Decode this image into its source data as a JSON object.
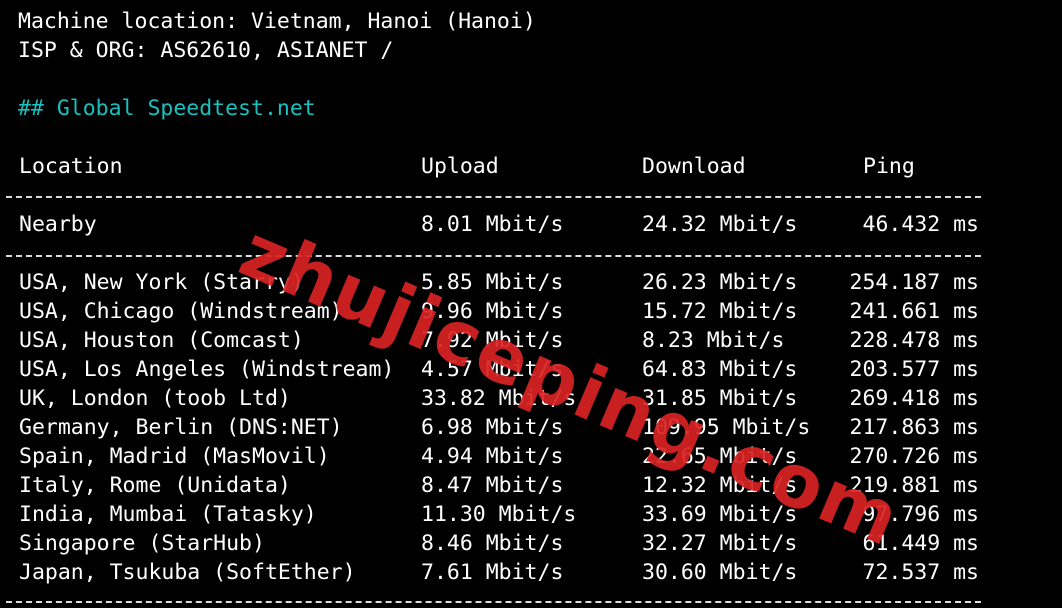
{
  "terminal": {
    "machine_location": "Machine location: Vietnam, Hanoi (Hanoi)",
    "isp_org": "ISP & ORG: AS62610, ASIANET /",
    "section_heading": "## Global Speedtest.net",
    "columns": {
      "location": "Location",
      "upload": "Upload",
      "download": "Download",
      "ping": "Ping"
    },
    "nearby": {
      "location": "Nearby",
      "upload": "8.01 Mbit/s",
      "download": "24.32 Mbit/s",
      "ping": "46.432 ms"
    },
    "rows": [
      {
        "location": "USA, New York (Starry)",
        "upload": "5.85 Mbit/s",
        "download": "26.23 Mbit/s",
        "ping": "254.187 ms"
      },
      {
        "location": "USA, Chicago (Windstream)",
        "upload": "9.96 Mbit/s",
        "download": "15.72 Mbit/s",
        "ping": "241.661 ms"
      },
      {
        "location": "USA, Houston (Comcast)",
        "upload": "7.92 Mbit/s",
        "download": "8.23 Mbit/s",
        "ping": "228.478 ms"
      },
      {
        "location": "USA, Los Angeles (Windstream)",
        "upload": "4.57 Mbit/s",
        "download": "64.83 Mbit/s",
        "ping": "203.577 ms"
      },
      {
        "location": "UK, London (toob Ltd)",
        "upload": "33.82 Mbit/s",
        "download": "31.85 Mbit/s",
        "ping": "269.418 ms"
      },
      {
        "location": "Germany, Berlin (DNS:NET)",
        "upload": "6.98 Mbit/s",
        "download": "109.95 Mbit/s",
        "ping": "217.863 ms"
      },
      {
        "location": "Spain, Madrid (MasMovil)",
        "upload": "4.94 Mbit/s",
        "download": "22.65 Mbit/s",
        "ping": "270.726 ms"
      },
      {
        "location": "Italy, Rome (Unidata)",
        "upload": "8.47 Mbit/s",
        "download": "12.32 Mbit/s",
        "ping": "219.881 ms"
      },
      {
        "location": "India, Mumbai (Tatasky)",
        "upload": "11.30 Mbit/s",
        "download": "33.69 Mbit/s",
        "ping": "97.796 ms"
      },
      {
        "location": "Singapore (StarHub)",
        "upload": "8.46 Mbit/s",
        "download": "32.27 Mbit/s",
        "ping": "61.449 ms"
      },
      {
        "location": "Japan, Tsukuba (SoftEther)",
        "upload": "7.61 Mbit/s",
        "download": "30.60 Mbit/s",
        "ping": "72.537 ms"
      }
    ]
  },
  "watermark": "zhujiceping.com",
  "colors": {
    "background": "#000000",
    "text": "#ffffff",
    "heading": "#19c0c0",
    "watermark": "#d92323"
  }
}
